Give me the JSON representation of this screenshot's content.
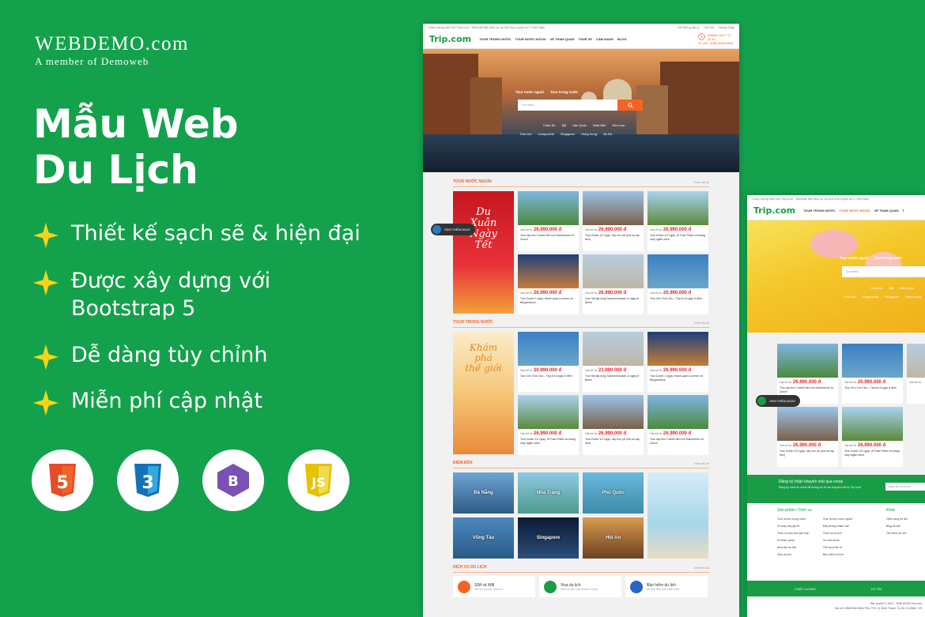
{
  "brand": {
    "title": "WEBDEMO.com",
    "subtitle": "A member of Demoweb"
  },
  "hero": {
    "title_line1": "Mẫu Web",
    "title_line2": "Du Lịch"
  },
  "features": [
    {
      "line1": "Thiết kế sạch sẽ & hiện đại",
      "line2": ""
    },
    {
      "line1": "Được xây dựng với",
      "line2": "Bootstrap 5"
    },
    {
      "line1": "Dễ dàng tùy chỉnh",
      "line2": ""
    },
    {
      "line1": "Miễn phí cập nhật",
      "line2": ""
    }
  ],
  "colors": {
    "background": "#14a14c",
    "accent": "#f26522",
    "star": "#f7d417",
    "price": "#e8242b"
  },
  "tech_badges": [
    {
      "icon": "html5-icon",
      "label": "5",
      "color": "#e44d26"
    },
    {
      "icon": "css3-icon",
      "label": "3",
      "color": "#1572b6"
    },
    {
      "icon": "bootstrap-icon",
      "label": "B",
      "color": "#7952b3"
    },
    {
      "icon": "js-icon",
      "label": "JS",
      "color": "#f0db4f"
    }
  ],
  "site": {
    "topbar_left": "Chào mừng đến với Trip.com - Website đặt dịch vụ du lịch trực tuyến số 1 Việt Nam",
    "topbar_right": [
      "Hệ thống đại lý",
      "Liên hệ",
      "Đăng nhập"
    ],
    "logo": "Trip.com",
    "nav": [
      "TOUR TRONG NƯỚC",
      "TOUR NƯỚC NGOÀI",
      "VÉ THAM QUAN",
      "THUÊ XE",
      "CẨM NANG",
      "BLOG"
    ],
    "nav2": [
      "TOUR TRONG NƯỚC",
      "TOUR NƯỚC NGOÀI",
      "VÉ THAM QUAN",
      "T"
    ],
    "hotline": [
      "Hotline: 0917 72 22 44",
      "Tư vấn: (028) 3838 6868"
    ],
    "search_tabs": [
      "Tour nước ngoài",
      "Tour trong nước"
    ],
    "search_placeholder": "Tìm kiếm...",
    "hot_line1": [
      "Châu Âu",
      "Mỹ",
      "Hàn Quốc",
      "Nhật Bản",
      "Đài Loan"
    ],
    "hot_line2": [
      "Thái Lan",
      "Campuchia",
      "Singapore",
      "Hong Kong",
      "Ấn Độ"
    ],
    "hot2_line1": [
      "Châu Âu",
      "Mỹ",
      "Hàn Quốc"
    ],
    "hot2_line2": [
      "Thái Lan",
      "Campuchia",
      "Singapore",
      "Hong Kong"
    ],
    "see_more": "Xem tất cả",
    "sec_foreign": "TOUR NƯỚC NGOÀI",
    "sec_domestic": "TOUR TRONG NƯỚC",
    "sec_dest": "ĐIỂM ĐẾN",
    "sec_service": "DỊCH VỤ DU LỊCH",
    "banner1": [
      "Du",
      "Xuân",
      "Ngày",
      "Tết"
    ],
    "banner2": [
      "Khám",
      "phá",
      "thế giới"
    ],
    "price_label": "Giá chỉ từ",
    "foreign_cards": [
      {
        "price": "26.990.000 đ",
        "name": "Tour cáp treo Cabri0 đến núi Stanserhorn từ Zurich"
      },
      {
        "price": "26.990.000 đ",
        "name": "Tour Zurich 1/2 ngày: city tour (đi phà và cáp treo)"
      },
      {
        "price": "26.990.000 đ",
        "name": "Tour Zurich 1/2 ngày: đi Thác Rhine và thang máy ngắm cảnh"
      },
      {
        "price": "26.990.000 đ",
        "name": "Tour Zurich 1 ngày: thành quan Lucerne và Bürgenstock"
      },
      {
        "price": "26.990.000 đ",
        "name": "Tour trải tập tung Sachsenhausen & ngày từ Berlin"
      },
      {
        "price": "20.990.000 đ",
        "name": "Tour Cửu Trại Câu – Tây An 6 ngày 6 đêm"
      }
    ],
    "domestic_cards": [
      {
        "price": "20.990.000 đ",
        "name": "Tour Cửu Trại Câu – Tây An 6 ngày 6 đêm"
      },
      {
        "price": "23.990.000 đ",
        "name": "Tour trải tập tung Sachsenhausen & ngày từ Berlin"
      },
      {
        "price": "26.990.000 đ",
        "name": "Tour Zurich 1 ngày: thành quan Lucerne và Bürgenstock"
      },
      {
        "price": "26.990.000 đ",
        "name": "Tour Zurich 1/2 ngày: đi Thác Rhine và thang máy ngắm cảnh"
      },
      {
        "price": "26.990.000 đ",
        "name": "Tour Zurich 1/2 ngày: city tour (đi phà và cáp treo)"
      },
      {
        "price": "26.990.000 đ",
        "name": "Tour cáp treo Cabri0 đến núi Stanserhorn từ Zurich"
      }
    ],
    "destinations": [
      "Đà Nẵng",
      "Nha Trang",
      "Phú Quốc",
      "Vũng Tàu",
      "Singapore",
      "Hội An"
    ],
    "services": [
      {
        "title": "SIM và Wifi",
        "sub": "Kết nối mọi lúc mọi nơi"
      },
      {
        "title": "Visa du lịch",
        "sub": "Dịch vụ làm visa nhanh chóng"
      },
      {
        "title": "Bảo hiểm du lịch",
        "sub": "An tâm trên mọi hành trình"
      }
    ],
    "float_btn": "XEM THÊM NGAY",
    "news_title": "Đăng ký nhận khuyến mãi qua email",
    "news_sub": "Đăng ký nhận tin email để không bỏ lỡ các khuyến mãi từ Trip.com",
    "news_placeholder": "Nhập địa chỉ email",
    "footer_col1_title": "Sản phẩm / Dịch vụ",
    "footer_col1": [
      "Tour du lịch trong nước",
      "Vé máy bay giá rẻ",
      "Thuê xe đưa đón sân bay",
      "Vé tham quan",
      "Mua sim du lịch",
      "Visa du lịch"
    ],
    "footer_col2": [
      "Tour du lịch nước ngoài",
      "Đặt phòng khách sạn",
      "Thuê xe du lịch",
      "Vé xem show",
      "Thủ tục phát vé",
      "Bảo hiểm du lịch"
    ],
    "footer_col3_title": "Khác",
    "footer_col3": [
      "Cẩm nang du lịch",
      "Blog du lịch",
      "Tài chính du lịch"
    ],
    "foot_bar": [
      "CHẤT LƯỢNG",
      "UY TÍN"
    ],
    "copyright": "Bản quyền © 2023 - Thiết kế bởi Trip.com",
    "address": "Địa chỉ: 456A Điện Biên Phủ, P22, Q. Bình Thạnh, Tp Hồ Chí Minh, VN"
  }
}
